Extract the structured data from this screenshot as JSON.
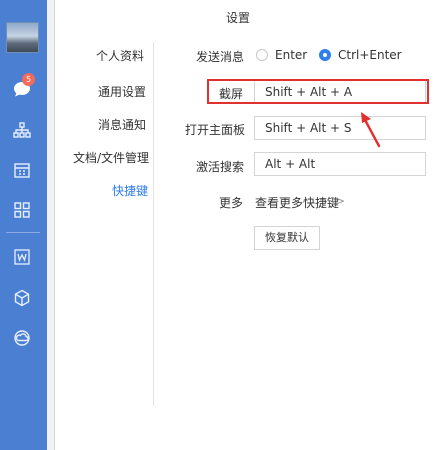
{
  "sidebar": {
    "badge_count": "5",
    "icons": [
      "avatar",
      "chat-icon",
      "org-icon",
      "calendar-icon",
      "apps-icon",
      "word-doc-icon",
      "cube-icon",
      "cloud-icon"
    ]
  },
  "window": {
    "title": "设置"
  },
  "nav": {
    "items": [
      {
        "label": "个人资料",
        "active": false
      },
      {
        "label": "通用设置",
        "active": false
      },
      {
        "label": "消息通知",
        "active": false
      },
      {
        "label": "文档/文件管理",
        "active": false
      },
      {
        "label": "快捷键",
        "active": true
      }
    ]
  },
  "shortcuts": {
    "send_label": "发送消息",
    "send_options": [
      {
        "label": "Enter",
        "selected": false
      },
      {
        "label": "Ctrl+Enter",
        "selected": true
      }
    ],
    "screenshot_label": "截屏",
    "screenshot_value": "Shift + Alt + A",
    "open_panel_label": "打开主面板",
    "open_panel_value": "Shift + Alt + S",
    "search_label": "激活搜索",
    "search_value": "Alt + Alt",
    "more_label": "更多",
    "more_link": "查看更多快捷键",
    "more_chevron": ">",
    "reset_button": "恢复默认"
  },
  "colors": {
    "sidebar": "#4a7fd1",
    "accent": "#2f7ee9",
    "highlight": "#e0302f",
    "badge": "#f26b5b"
  }
}
